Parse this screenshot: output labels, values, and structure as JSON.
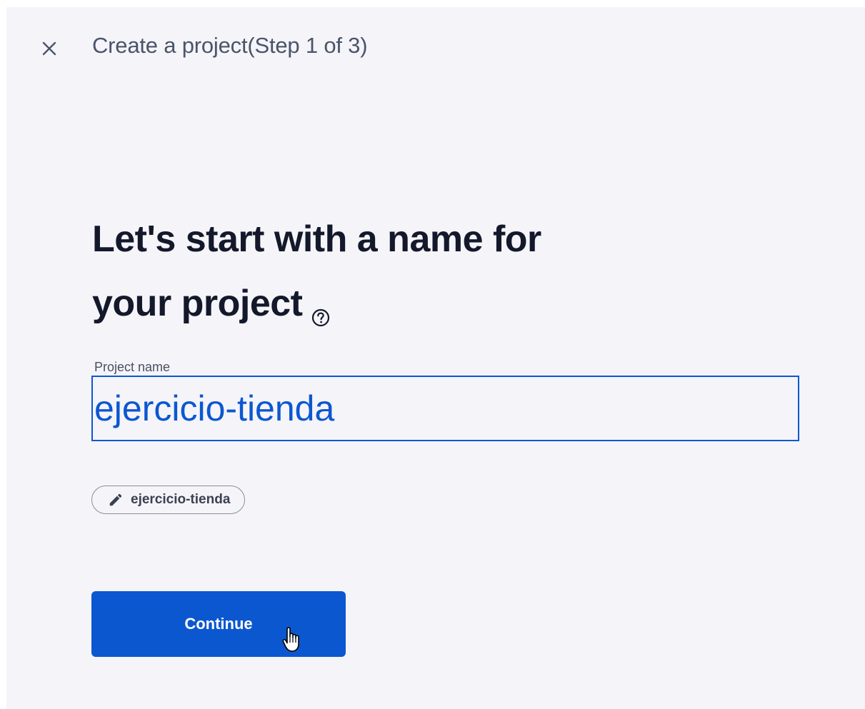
{
  "header": {
    "close_icon": "close-icon",
    "title": "Create a project(Step 1 of 3)"
  },
  "main": {
    "heading_line1": "Let's start with a name for",
    "heading_line2": "your project",
    "help_icon": "help-circle-icon",
    "project_name": {
      "label": "Project name",
      "value": "ejercicio-tienda"
    },
    "project_id_chip": {
      "icon": "pencil-icon",
      "label": "ejercicio-tienda"
    },
    "continue_label": "Continue"
  },
  "colors": {
    "primary": "#0b57d0",
    "background": "#f5f4f9",
    "heading": "#13192b"
  }
}
